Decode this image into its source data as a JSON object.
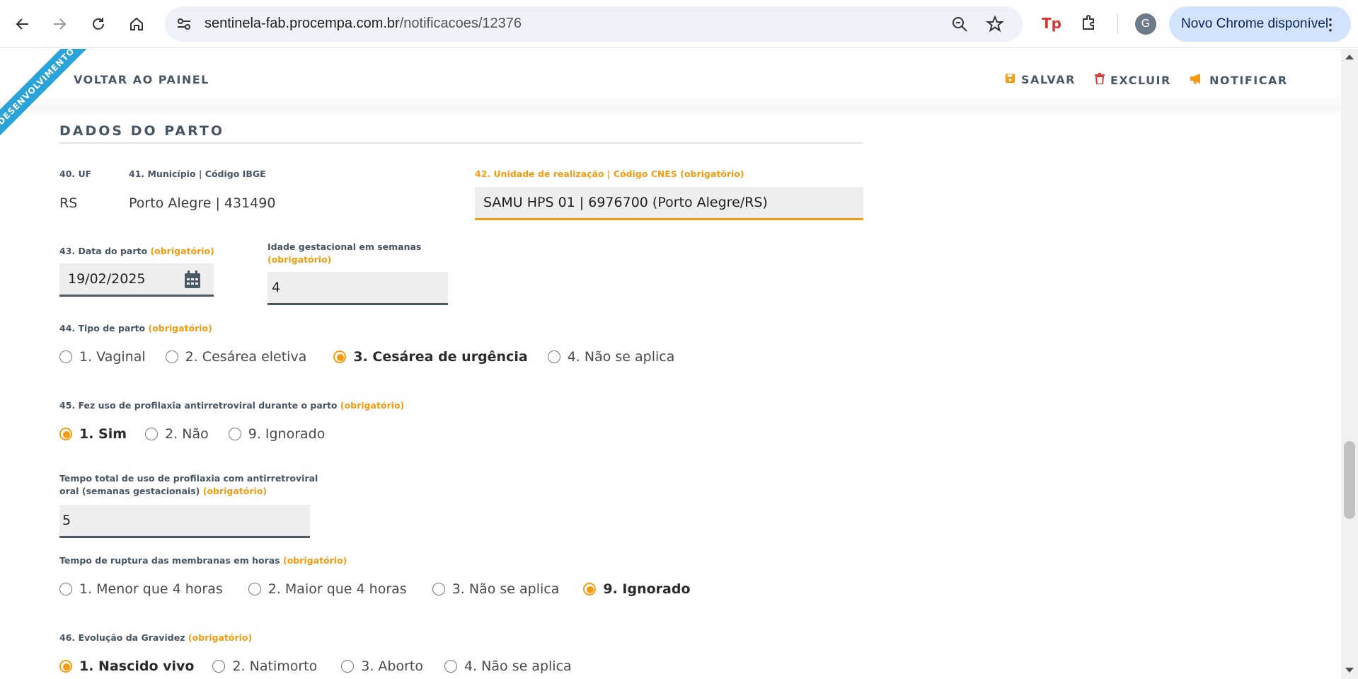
{
  "browser": {
    "url_host": "sentinela-fab.procempa.com.br",
    "url_path": "/notificacoes/12376",
    "avatar_letter": "G",
    "update_label": "Novo Chrome disponível"
  },
  "header": {
    "ribbon": "DESENVOLVIMENTO",
    "back_label": "VOLTAR AO PAINEL",
    "save_label": "SALVAR",
    "delete_label": "EXCLUIR",
    "notify_label": "NOTIFICAR"
  },
  "section": {
    "title": "DADOS DO PARTO"
  },
  "required_text": "(obrigatório)",
  "fields": {
    "uf_label": "40. UF",
    "uf_value": "RS",
    "municipio_label": "41. Município | Código IBGE",
    "municipio_value": "Porto Alegre | 431490",
    "unidade_label": "42. Unidade de realização | Código CNES (obrigatório)",
    "unidade_value": "SAMU HPS 01 | 6976700  (Porto Alegre/RS)",
    "data_parto_label": "43. Data do parto",
    "data_parto_value": "19/02/2025",
    "idade_label": "Idade gestacional em semanas",
    "idade_value": "4",
    "tipo_parto_label": "44. Tipo de parto",
    "tipo_parto_options": [
      "1. Vaginal",
      "2. Cesárea eletiva",
      "3. Cesárea de urgência",
      "4. Não se aplica"
    ],
    "profilaxia_label": "45. Fez uso de profilaxia antirretroviral durante o parto",
    "profilaxia_options": [
      "1. Sim",
      "2. Não",
      "9. Ignorado"
    ],
    "tempo_profilaxia_label_1": "Tempo total de uso de profilaxia com antirretroviral",
    "tempo_profilaxia_label_2": "oral (semanas gestacionais)",
    "tempo_profilaxia_value": "5",
    "ruptura_label": "Tempo de ruptura das membranas em horas",
    "ruptura_options": [
      "1. Menor que 4 horas",
      "2. Maior que 4 horas",
      "3. Não se aplica",
      "9. Ignorado"
    ],
    "evolucao_label": "46. Evolução da Gravidez",
    "evolucao_options": [
      "1. Nascido vivo",
      "2. Natimorto",
      "3. Aborto",
      "4. Não se aplica"
    ]
  },
  "colors": {
    "accent": "#f39c12",
    "ribbon": "#2aa3d8",
    "text": "#475563"
  }
}
